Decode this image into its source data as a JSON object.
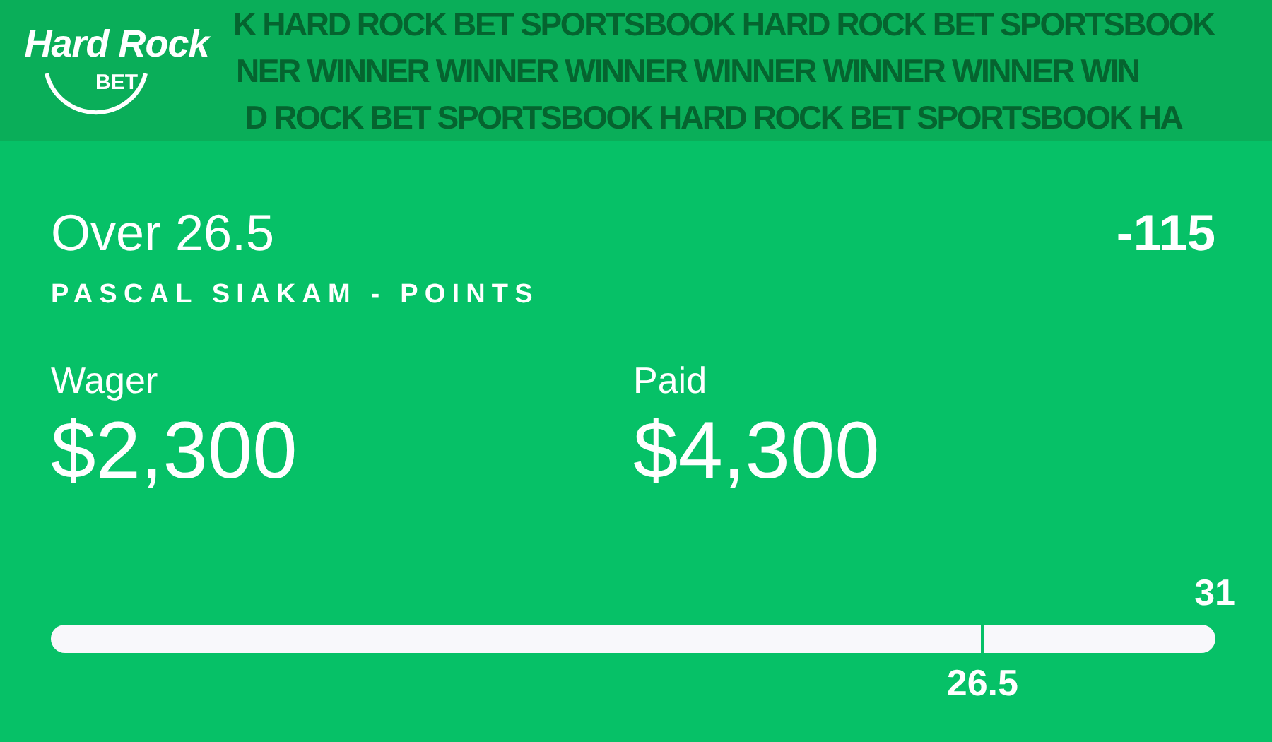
{
  "header": {
    "logo": {
      "wordmark": "Hard Rock",
      "sub": "BET"
    },
    "banner_lines": [
      "K HARD ROCK BET SPORTSBOOK HARD ROCK BET SPORTSBOOK",
      "NER WINNER WINNER WINNER WINNER WINNER WINNER WIN",
      "D ROCK BET SPORTSBOOK HARD ROCK BET SPORTSBOOK HA"
    ]
  },
  "bet": {
    "selection": "Over 26.5",
    "odds": "-115",
    "market": "PASCAL SIAKAM - POINTS",
    "amounts": [
      {
        "label": "Wager",
        "value": "$2,300"
      },
      {
        "label": "Paid",
        "value": "$4,300"
      }
    ],
    "progress": {
      "end_label": "31",
      "line": {
        "level": 0.8,
        "label": "26.5"
      }
    }
  }
}
